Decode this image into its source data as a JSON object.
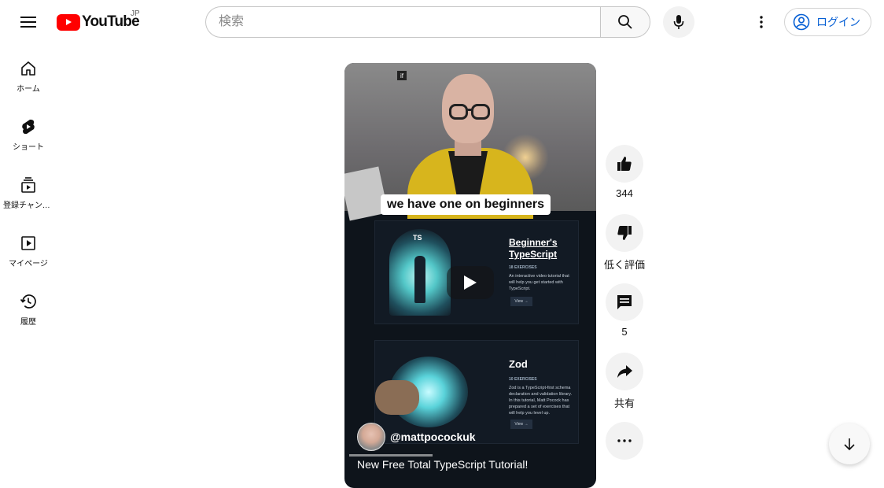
{
  "header": {
    "logo_text": "YouTube",
    "country_code": "JP",
    "search_placeholder": "検索",
    "login_label": "ログイン"
  },
  "sidebar": {
    "items": [
      {
        "label": "ホーム",
        "icon": "home-icon"
      },
      {
        "label": "ショート",
        "icon": "shorts-icon"
      },
      {
        "label": "登録チャンネル",
        "icon": "subscriptions-icon"
      },
      {
        "label": "マイページ",
        "icon": "you-icon"
      },
      {
        "label": "履歴",
        "icon": "history-icon"
      }
    ]
  },
  "video": {
    "corner_badge": "if",
    "caption": "we have one on beginners",
    "cards": [
      {
        "badge": "TS",
        "title": "Beginner's TypeScript",
        "subtitle": "18 EXERCISES",
        "description": "An interactive video tutorial that will help you get started with TypeScript.",
        "button": "View →"
      },
      {
        "title": "Zod",
        "subtitle": "10 EXERCISES",
        "description": "Zod is a TypeScript-first schema declaration and validation library. In this tutorial, Matt Pocock has prepared a set of exercises that will help you level up.",
        "button": "View →"
      }
    ],
    "channel_name": "@mattpocockuk",
    "title": "New Free Total TypeScript Tutorial!"
  },
  "actions": {
    "like_count": "344",
    "dislike_label": "低く評価",
    "comment_count": "5",
    "share_label": "共有"
  },
  "colors": {
    "brand_red": "#ff0000",
    "link_blue": "#065fd4",
    "video_bg": "#0e141b"
  }
}
